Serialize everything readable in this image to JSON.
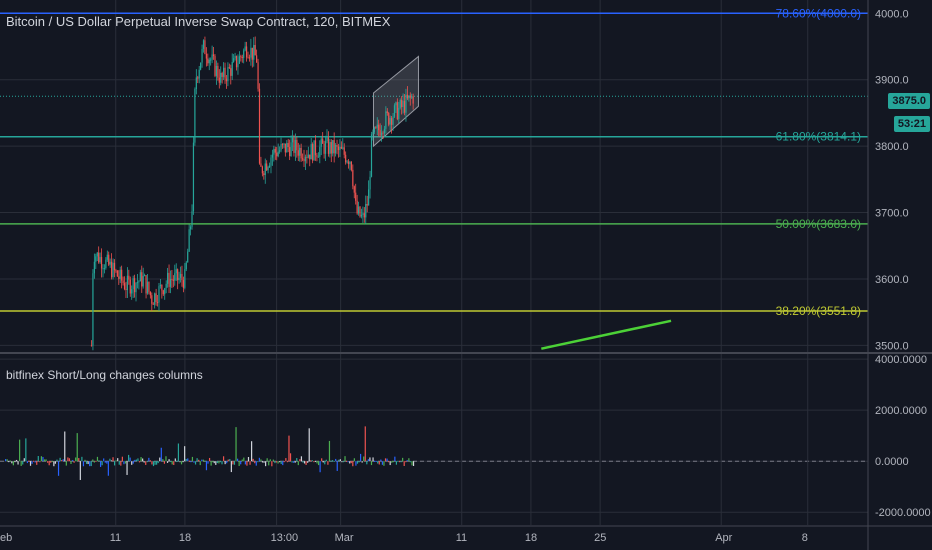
{
  "title": "Bitcoin / US Dollar Perpetual Inverse Swap Contract, 120, BITMEX",
  "indicator_title": "bitfinex Short/Long changes columns",
  "last_price": "3875.0",
  "countdown": "53:21",
  "colors": {
    "background": "#131722",
    "up": "#26a69a",
    "down": "#ef5350",
    "fib_786": "#2962ff",
    "fib_618": "#26a69a",
    "fib_500": "#4caf50",
    "fib_382": "#c0ca33",
    "trendline": "#4cd137",
    "channel": "#9598a1",
    "tag": "#26a69a"
  },
  "chart_data": [
    {
      "type": "candlestick",
      "y_ticks": [
        "4000.0",
        "3900.0",
        "3800.0",
        "3700.0",
        "3600.0",
        "3500.0"
      ],
      "x_ticks": [
        "11",
        "18",
        "13:00",
        "Mar",
        "11",
        "18",
        "25",
        "Apr",
        "8"
      ],
      "x_left_cut_label": "eb",
      "fib_levels": [
        {
          "ratio": "78.60%",
          "price": 4000.0,
          "label": "78.60%(4000.0)"
        },
        {
          "ratio": "61.80%",
          "price": 3814.1,
          "label": "61.80%(3814.1)"
        },
        {
          "ratio": "50.00%",
          "price": 3683.0,
          "label": "50.00%(3683.0)"
        },
        {
          "ratio": "38.20%",
          "price": 3551.8,
          "label": "38.20%(3551.8)"
        }
      ],
      "ylim": [
        3490,
        4020
      ],
      "approx_path": [
        {
          "day": 5.0,
          "price": 3500
        },
        {
          "day": 5.1,
          "price": 3640
        },
        {
          "day": 6.0,
          "price": 3620
        },
        {
          "day": 7.0,
          "price": 3590
        },
        {
          "day": 8.0,
          "price": 3600
        },
        {
          "day": 8.5,
          "price": 3570
        },
        {
          "day": 9.5,
          "price": 3600
        },
        {
          "day": 10.4,
          "price": 3600
        },
        {
          "day": 10.8,
          "price": 3700
        },
        {
          "day": 11.0,
          "price": 3900
        },
        {
          "day": 11.5,
          "price": 3950
        },
        {
          "day": 12.5,
          "price": 3900
        },
        {
          "day": 13.5,
          "price": 3930
        },
        {
          "day": 14.0,
          "price": 3950
        },
        {
          "day": 14.6,
          "price": 3930
        },
        {
          "day": 14.7,
          "price": 3760
        },
        {
          "day": 15.5,
          "price": 3790
        },
        {
          "day": 16.5,
          "price": 3800
        },
        {
          "day": 17.5,
          "price": 3790
        },
        {
          "day": 18.5,
          "price": 3800
        },
        {
          "day": 19.5,
          "price": 3790
        },
        {
          "day": 20.0,
          "price": 3780
        },
        {
          "day": 20.3,
          "price": 3700
        },
        {
          "day": 20.7,
          "price": 3690
        },
        {
          "day": 21.0,
          "price": 3720
        },
        {
          "day": 21.2,
          "price": 3810
        },
        {
          "day": 22.0,
          "price": 3840
        },
        {
          "day": 23.0,
          "price": 3860
        },
        {
          "day": 23.6,
          "price": 3875
        }
      ],
      "channel": {
        "from_day": 21.3,
        "to_day": 23.9,
        "lower_start": 3800,
        "lower_end": 3860,
        "upper_start": 3880,
        "upper_end": 3935
      },
      "trendline": {
        "from_day": 31.0,
        "to_day": 38.5,
        "from_price": 3495,
        "to_price": 3537
      }
    },
    {
      "type": "bar",
      "name": "bitfinex Short/Long changes columns",
      "y_ticks": [
        "4000.0000",
        "2000.0000",
        "0.0000",
        "-2000.0000"
      ],
      "ylim": [
        -2500,
        4200
      ],
      "day_range": [
        0,
        23.6
      ]
    }
  ]
}
